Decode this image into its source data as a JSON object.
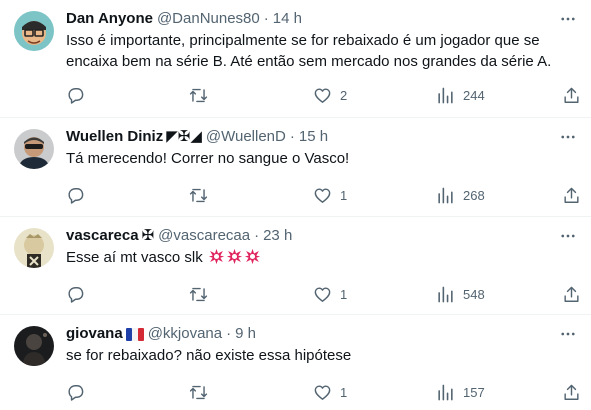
{
  "tweets": [
    {
      "name": "Dan Anyone",
      "badges": "",
      "handle": "@DanNunes80",
      "sep": "·",
      "time": "14 h",
      "text": "Isso é importante, principalmente se for rebaixado é um jogador que se encaixa bem na série B. Até então sem mercado nos grandes da série A.",
      "likes": "2",
      "views": "244"
    },
    {
      "name": "Wuellen Diniz",
      "badges": "◤✠◢",
      "handle": "@WuellenD",
      "sep": "·",
      "time": "15 h",
      "text": "Tá merecendo! Correr no sangue o Vasco!",
      "likes": "1",
      "views": "268"
    },
    {
      "name": "vascareca",
      "badges": "✠",
      "handle": "@vascarecaa",
      "sep": "·",
      "time": "23 h",
      "text": "Esse aí mt vasco slk",
      "likes": "1",
      "views": "548"
    },
    {
      "name": "giovana",
      "badges": "🇫🇷",
      "handle": "@kkjovana",
      "sep": "·",
      "time": "9 h",
      "text": "se for rebaixado? não existe essa hipótese",
      "likes": "1",
      "views": "157"
    }
  ],
  "icons": {
    "reply": "reply-icon",
    "retweet": "retweet-icon",
    "like": "heart-icon",
    "views": "views-icon",
    "share": "share-icon",
    "more": "more-icon",
    "emoji": "anger-symbol-icon"
  },
  "colors": {
    "text": "#0f1419",
    "muted": "#536471",
    "divider": "#eff3f4",
    "anger": "#e0245e"
  }
}
